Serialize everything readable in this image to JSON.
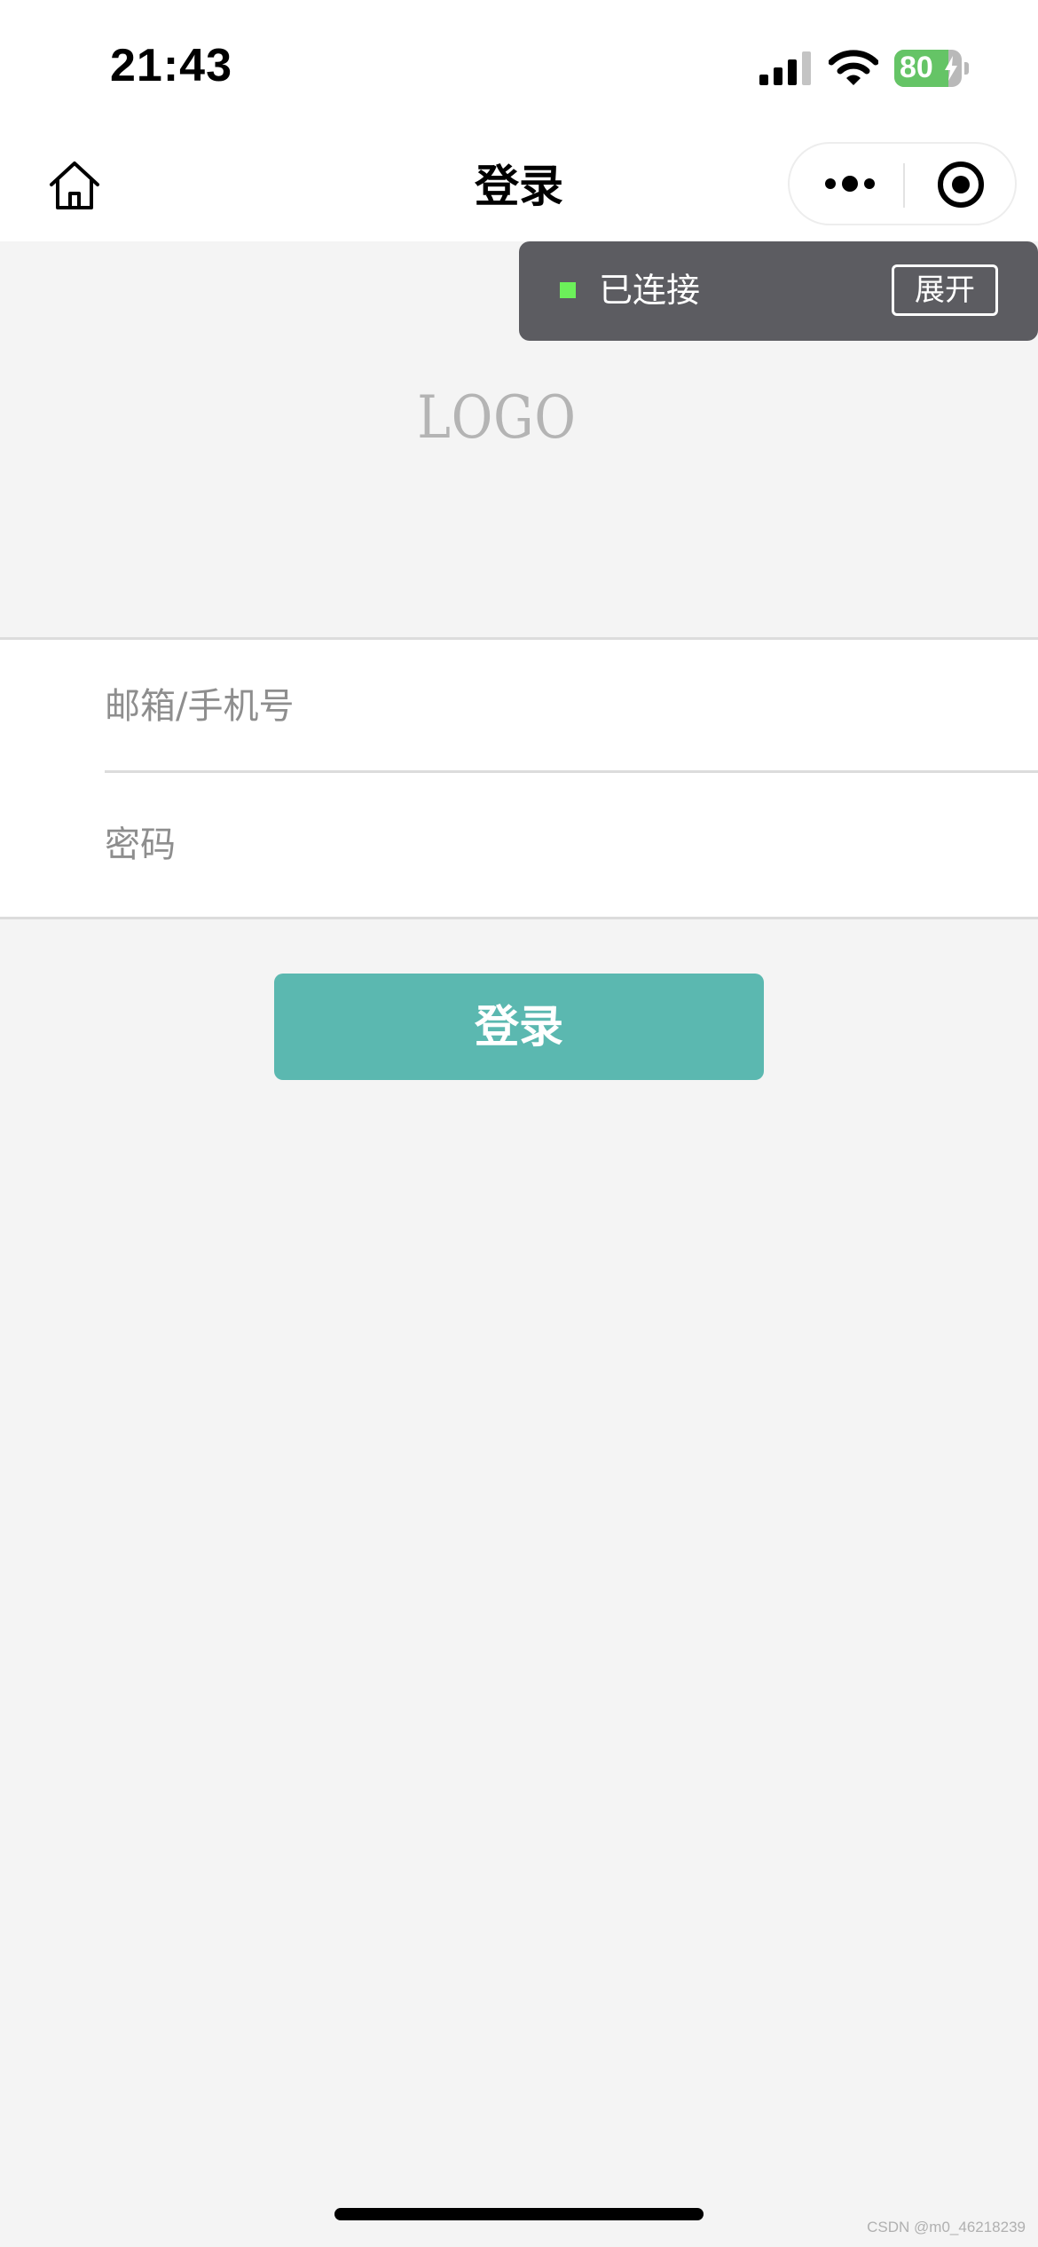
{
  "status_bar": {
    "time": "21:43",
    "battery_level": "80",
    "signal_icon": "cellular-signal-icon",
    "wifi_icon": "wifi-icon",
    "charging_icon": "charging-bolt-icon"
  },
  "nav": {
    "title": "登录",
    "home_icon": "home-icon",
    "more_icon": "more-dots-icon",
    "close_icon": "close-miniprogram-icon"
  },
  "toast": {
    "status_label": "已连接",
    "expand_button": "展开",
    "status_color": "#6cf05a"
  },
  "logo": {
    "text": "LOGO"
  },
  "form": {
    "account_placeholder": "邮箱/手机号",
    "password_placeholder": "密码"
  },
  "login_button": {
    "label": "登录",
    "color": "#5bb8b0"
  },
  "watermark": {
    "text": "CSDN @m0_46218239"
  }
}
